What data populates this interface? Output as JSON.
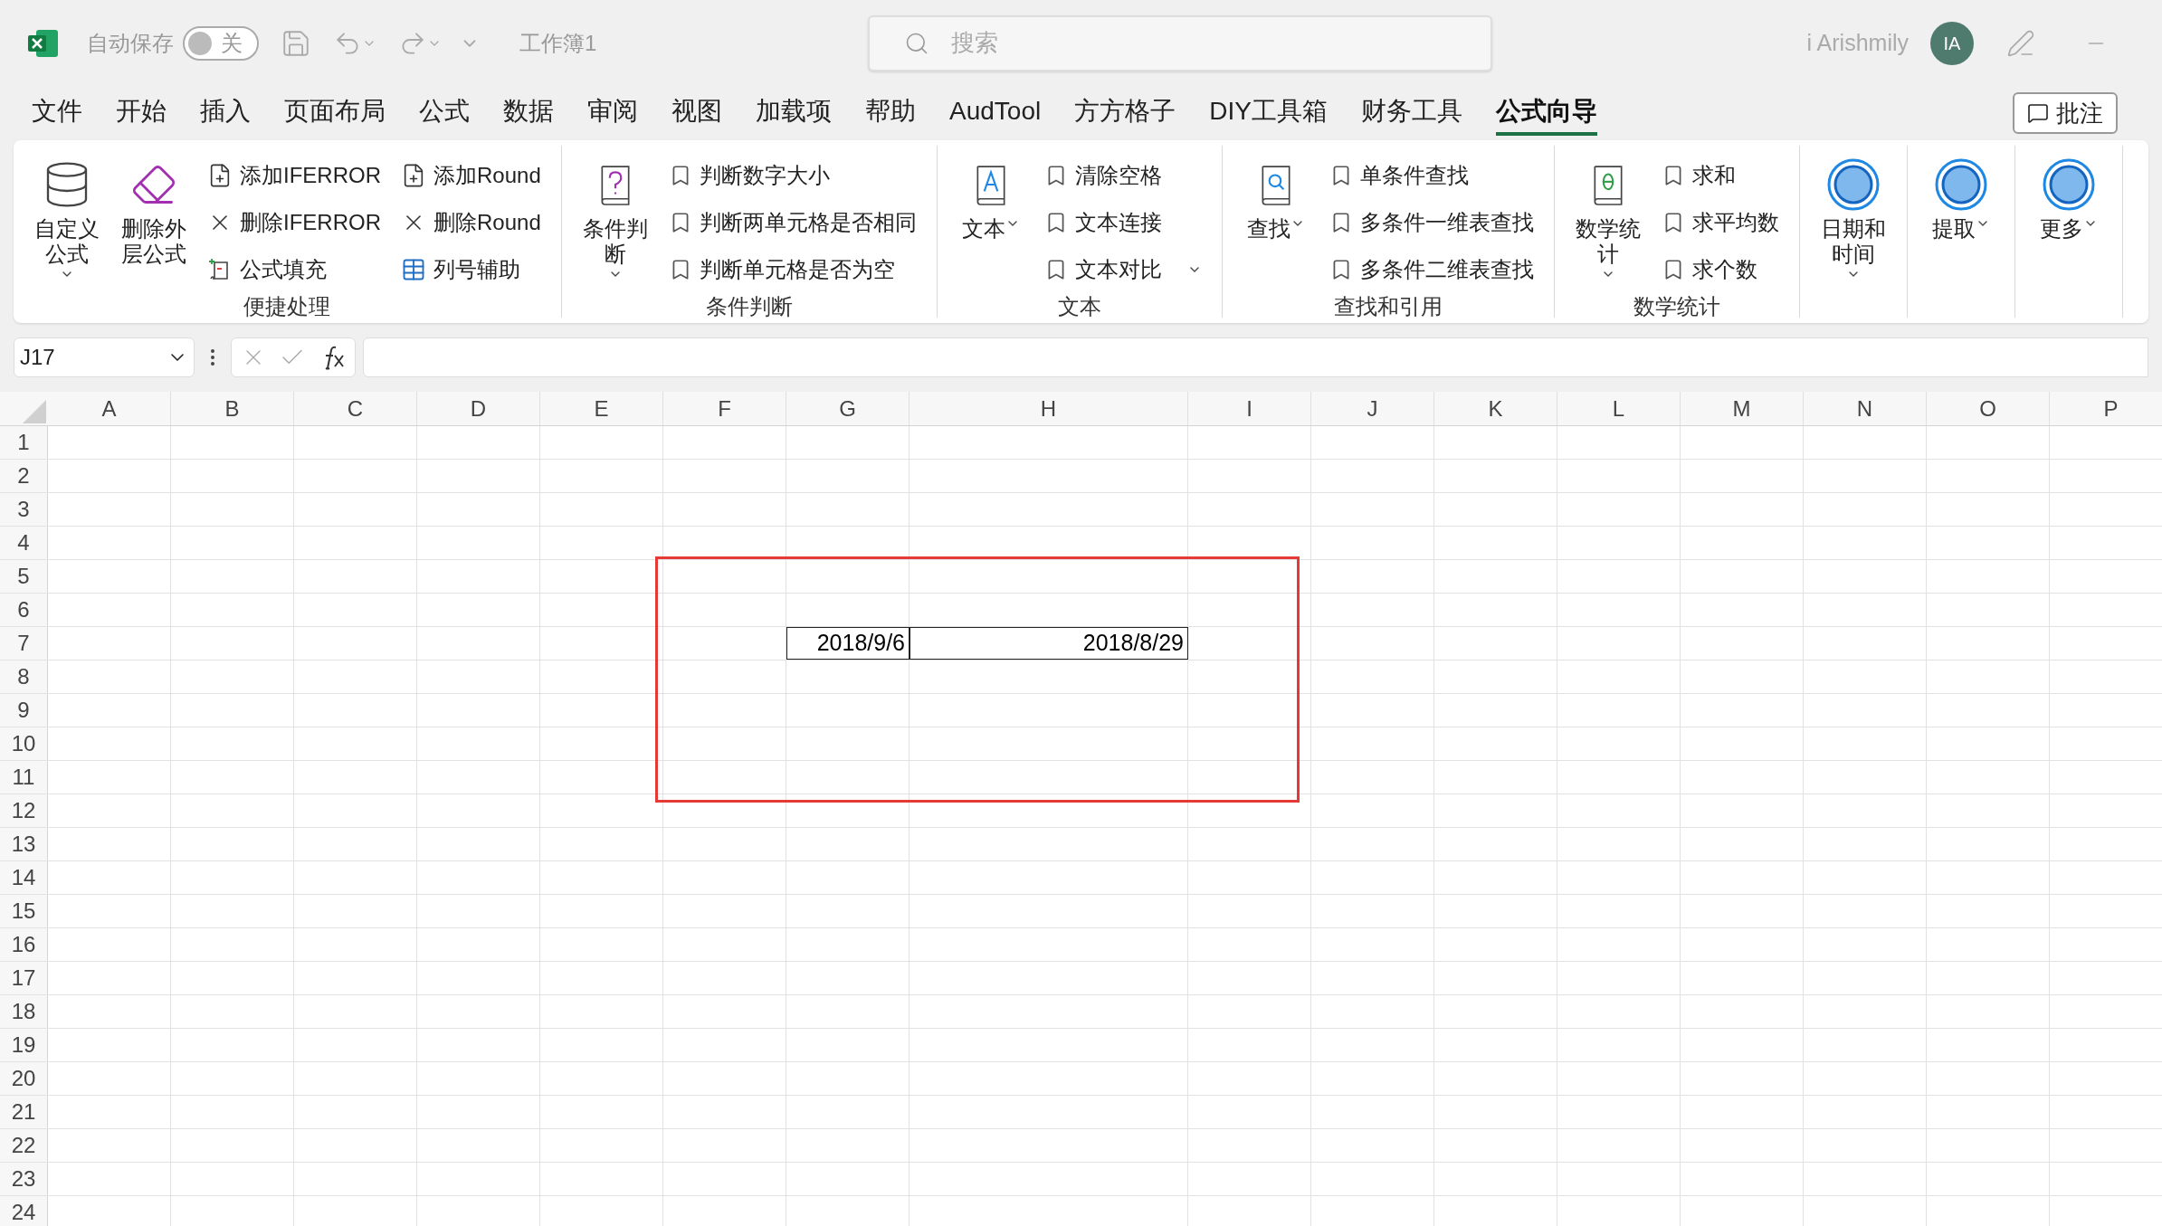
{
  "title_bar": {
    "autosave_label": "自动保存",
    "autosave": {
      "on": false,
      "label": "关"
    },
    "workbook": "工作簿1",
    "search": {
      "placeholder": "搜索"
    },
    "user": "i Arishmily",
    "avatar": "IA"
  },
  "menu": [
    {
      "label": "文件",
      "selected": false
    },
    {
      "label": "开始",
      "selected": false
    },
    {
      "label": "插入",
      "selected": false
    },
    {
      "label": "页面布局",
      "selected": false
    },
    {
      "label": "公式",
      "selected": false
    },
    {
      "label": "数据",
      "selected": false
    },
    {
      "label": "审阅",
      "selected": false
    },
    {
      "label": "视图",
      "selected": false
    },
    {
      "label": "加载项",
      "selected": false
    },
    {
      "label": "帮助",
      "selected": false
    },
    {
      "label": "AudTool",
      "selected": false
    },
    {
      "label": "方方格子",
      "selected": false
    },
    {
      "label": "DIY工具箱",
      "selected": false
    },
    {
      "label": "财务工具",
      "selected": false
    },
    {
      "label": "公式向导",
      "selected": true
    }
  ],
  "comment_button": "批注",
  "ribbon": [
    {
      "label": "便捷处理",
      "large": [
        {
          "kind": "formula-db",
          "label": "自定义公式",
          "dropdown": true
        },
        {
          "kind": "eraser",
          "label": "删除外层公式",
          "dropdown": false
        }
      ],
      "columns": [
        [
          {
            "kind": "add",
            "label": "添加IFERROR"
          },
          {
            "kind": "remove",
            "label": "删除IFERROR"
          },
          {
            "kind": "fill",
            "label": "公式填充"
          }
        ],
        [
          {
            "kind": "add",
            "label": "添加Round"
          },
          {
            "kind": "remove",
            "label": "删除Round"
          },
          {
            "kind": "grid",
            "label": "列号辅助"
          }
        ]
      ]
    },
    {
      "label": "条件判断",
      "large": [
        {
          "kind": "question-book",
          "label": "条件判断",
          "dropdown": true
        }
      ],
      "columns": [
        [
          {
            "kind": "bookmark",
            "label": "判断数字大小"
          },
          {
            "kind": "bookmark",
            "label": "判断两单元格是否相同"
          },
          {
            "kind": "bookmark",
            "label": "判断单元格是否为空"
          }
        ]
      ]
    },
    {
      "label": "文本",
      "large": [
        {
          "kind": "text-book",
          "label": "文本",
          "dropdown": true
        }
      ],
      "columns": [
        [
          {
            "kind": "bookmark",
            "label": "清除空格"
          },
          {
            "kind": "bookmark",
            "label": "文本连接"
          },
          {
            "kind": "bookmark",
            "label": "文本对比",
            "dropdown": true
          }
        ]
      ]
    },
    {
      "label": "查找和引用",
      "large": [
        {
          "kind": "search-book",
          "label": "查找",
          "dropdown": true
        }
      ],
      "columns": [
        [
          {
            "kind": "bookmark",
            "label": "单条件查找"
          },
          {
            "kind": "bookmark",
            "label": "多条件一维表查找"
          },
          {
            "kind": "bookmark",
            "label": "多条件二维表查找"
          }
        ]
      ]
    },
    {
      "label": "数学统计",
      "large": [
        {
          "kind": "theta-book",
          "label": "数学统计",
          "dropdown": true
        }
      ],
      "columns": [
        [
          {
            "kind": "bookmark",
            "label": "求和"
          },
          {
            "kind": "bookmark",
            "label": "求平均数"
          },
          {
            "kind": "bookmark",
            "label": "求个数"
          }
        ]
      ]
    },
    {
      "large": [
        {
          "kind": "circle",
          "label": "日期和时间",
          "dropdown": true
        }
      ]
    },
    {
      "large": [
        {
          "kind": "circle",
          "label": "提取",
          "dropdown": true
        }
      ]
    },
    {
      "large": [
        {
          "kind": "circle",
          "label": "更多",
          "dropdown": true
        }
      ]
    }
  ],
  "name_box": "J17",
  "columns": [
    "A",
    "B",
    "C",
    "D",
    "E",
    "F",
    "G",
    "H",
    "I",
    "J",
    "K",
    "L",
    "M",
    "N",
    "O",
    "P"
  ],
  "rows": [
    {
      "label": "1"
    },
    {
      "label": "2"
    },
    {
      "label": "3"
    },
    {
      "label": "4"
    },
    {
      "label": "5"
    },
    {
      "label": "6"
    },
    {
      "label": "7",
      "cells": [
        null,
        null,
        null,
        null,
        null,
        null,
        "2018/9/6",
        "2018/8/29"
      ]
    },
    {
      "label": "8"
    },
    {
      "label": "9"
    },
    {
      "label": "10"
    },
    {
      "label": "11"
    },
    {
      "label": "12"
    },
    {
      "label": "13"
    },
    {
      "label": "14"
    },
    {
      "label": "15"
    },
    {
      "label": "16"
    },
    {
      "label": "17"
    },
    {
      "label": "18"
    },
    {
      "label": "19"
    },
    {
      "label": "20"
    },
    {
      "label": "21"
    },
    {
      "label": "22"
    },
    {
      "label": "23"
    },
    {
      "label": "24"
    }
  ],
  "annotation": {
    "kind": "rectangle"
  }
}
